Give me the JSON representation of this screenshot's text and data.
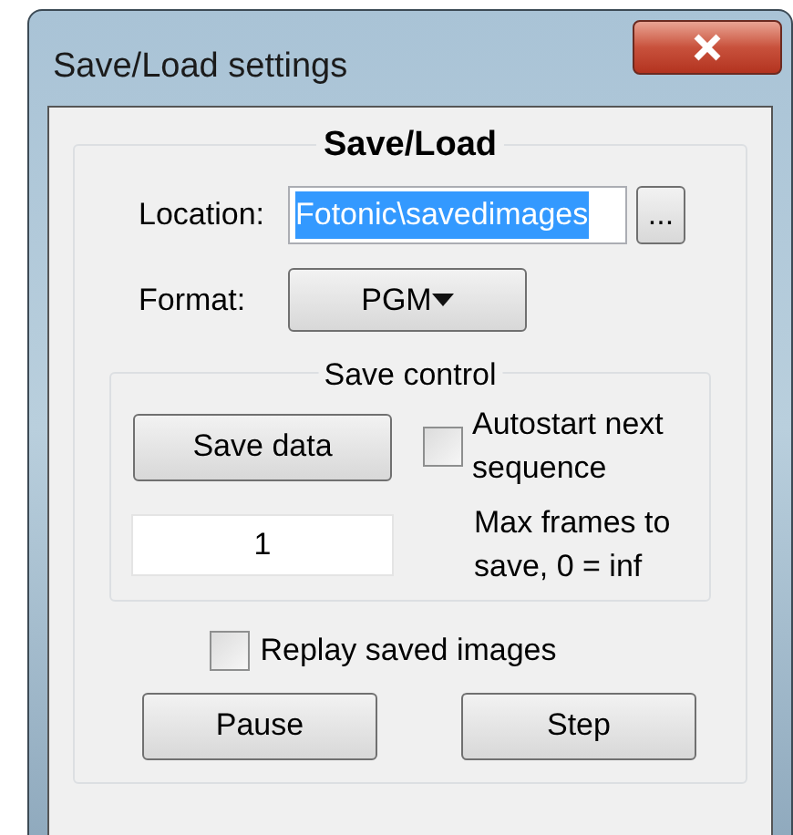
{
  "window": {
    "title": "Save/Load settings"
  },
  "group": {
    "title": "Save/Load"
  },
  "location": {
    "label": "Location:",
    "value": "Fotonic\\savedimages",
    "selected": true,
    "browse": "..."
  },
  "format": {
    "label": "Format:",
    "value": "PGM"
  },
  "save_control": {
    "title": "Save control",
    "save_button": "Save data",
    "autostart": {
      "label": "Autostart next sequence",
      "checked": false
    },
    "max_frames": {
      "value": "1",
      "label": "Max frames to save, 0 = inf"
    }
  },
  "replay": {
    "label": "Replay saved images",
    "checked": false
  },
  "buttons": [
    "Pause",
    "Step"
  ]
}
